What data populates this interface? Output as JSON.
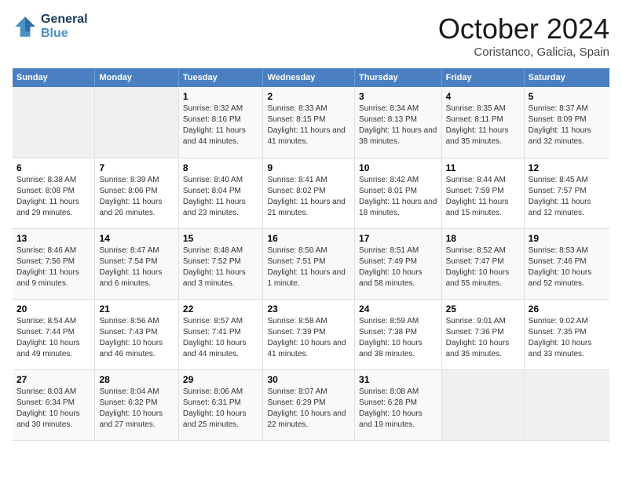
{
  "logo": {
    "line1": "General",
    "line2": "Blue"
  },
  "title": "October 2024",
  "location": "Coristanco, Galicia, Spain",
  "weekdays": [
    "Sunday",
    "Monday",
    "Tuesday",
    "Wednesday",
    "Thursday",
    "Friday",
    "Saturday"
  ],
  "weeks": [
    [
      {
        "day": "",
        "detail": ""
      },
      {
        "day": "",
        "detail": ""
      },
      {
        "day": "1",
        "detail": "Sunrise: 8:32 AM\nSunset: 8:16 PM\nDaylight: 11 hours and 44 minutes."
      },
      {
        "day": "2",
        "detail": "Sunrise: 8:33 AM\nSunset: 8:15 PM\nDaylight: 11 hours and 41 minutes."
      },
      {
        "day": "3",
        "detail": "Sunrise: 8:34 AM\nSunset: 8:13 PM\nDaylight: 11 hours and 38 minutes."
      },
      {
        "day": "4",
        "detail": "Sunrise: 8:35 AM\nSunset: 8:11 PM\nDaylight: 11 hours and 35 minutes."
      },
      {
        "day": "5",
        "detail": "Sunrise: 8:37 AM\nSunset: 8:09 PM\nDaylight: 11 hours and 32 minutes."
      }
    ],
    [
      {
        "day": "6",
        "detail": "Sunrise: 8:38 AM\nSunset: 8:08 PM\nDaylight: 11 hours and 29 minutes."
      },
      {
        "day": "7",
        "detail": "Sunrise: 8:39 AM\nSunset: 8:06 PM\nDaylight: 11 hours and 26 minutes."
      },
      {
        "day": "8",
        "detail": "Sunrise: 8:40 AM\nSunset: 8:04 PM\nDaylight: 11 hours and 23 minutes."
      },
      {
        "day": "9",
        "detail": "Sunrise: 8:41 AM\nSunset: 8:02 PM\nDaylight: 11 hours and 21 minutes."
      },
      {
        "day": "10",
        "detail": "Sunrise: 8:42 AM\nSunset: 8:01 PM\nDaylight: 11 hours and 18 minutes."
      },
      {
        "day": "11",
        "detail": "Sunrise: 8:44 AM\nSunset: 7:59 PM\nDaylight: 11 hours and 15 minutes."
      },
      {
        "day": "12",
        "detail": "Sunrise: 8:45 AM\nSunset: 7:57 PM\nDaylight: 11 hours and 12 minutes."
      }
    ],
    [
      {
        "day": "13",
        "detail": "Sunrise: 8:46 AM\nSunset: 7:56 PM\nDaylight: 11 hours and 9 minutes."
      },
      {
        "day": "14",
        "detail": "Sunrise: 8:47 AM\nSunset: 7:54 PM\nDaylight: 11 hours and 6 minutes."
      },
      {
        "day": "15",
        "detail": "Sunrise: 8:48 AM\nSunset: 7:52 PM\nDaylight: 11 hours and 3 minutes."
      },
      {
        "day": "16",
        "detail": "Sunrise: 8:50 AM\nSunset: 7:51 PM\nDaylight: 11 hours and 1 minute."
      },
      {
        "day": "17",
        "detail": "Sunrise: 8:51 AM\nSunset: 7:49 PM\nDaylight: 10 hours and 58 minutes."
      },
      {
        "day": "18",
        "detail": "Sunrise: 8:52 AM\nSunset: 7:47 PM\nDaylight: 10 hours and 55 minutes."
      },
      {
        "day": "19",
        "detail": "Sunrise: 8:53 AM\nSunset: 7:46 PM\nDaylight: 10 hours and 52 minutes."
      }
    ],
    [
      {
        "day": "20",
        "detail": "Sunrise: 8:54 AM\nSunset: 7:44 PM\nDaylight: 10 hours and 49 minutes."
      },
      {
        "day": "21",
        "detail": "Sunrise: 8:56 AM\nSunset: 7:43 PM\nDaylight: 10 hours and 46 minutes."
      },
      {
        "day": "22",
        "detail": "Sunrise: 8:57 AM\nSunset: 7:41 PM\nDaylight: 10 hours and 44 minutes."
      },
      {
        "day": "23",
        "detail": "Sunrise: 8:58 AM\nSunset: 7:39 PM\nDaylight: 10 hours and 41 minutes."
      },
      {
        "day": "24",
        "detail": "Sunrise: 8:59 AM\nSunset: 7:38 PM\nDaylight: 10 hours and 38 minutes."
      },
      {
        "day": "25",
        "detail": "Sunrise: 9:01 AM\nSunset: 7:36 PM\nDaylight: 10 hours and 35 minutes."
      },
      {
        "day": "26",
        "detail": "Sunrise: 9:02 AM\nSunset: 7:35 PM\nDaylight: 10 hours and 33 minutes."
      }
    ],
    [
      {
        "day": "27",
        "detail": "Sunrise: 8:03 AM\nSunset: 6:34 PM\nDaylight: 10 hours and 30 minutes."
      },
      {
        "day": "28",
        "detail": "Sunrise: 8:04 AM\nSunset: 6:32 PM\nDaylight: 10 hours and 27 minutes."
      },
      {
        "day": "29",
        "detail": "Sunrise: 8:06 AM\nSunset: 6:31 PM\nDaylight: 10 hours and 25 minutes."
      },
      {
        "day": "30",
        "detail": "Sunrise: 8:07 AM\nSunset: 6:29 PM\nDaylight: 10 hours and 22 minutes."
      },
      {
        "day": "31",
        "detail": "Sunrise: 8:08 AM\nSunset: 6:28 PM\nDaylight: 10 hours and 19 minutes."
      },
      {
        "day": "",
        "detail": ""
      },
      {
        "day": "",
        "detail": ""
      }
    ]
  ]
}
